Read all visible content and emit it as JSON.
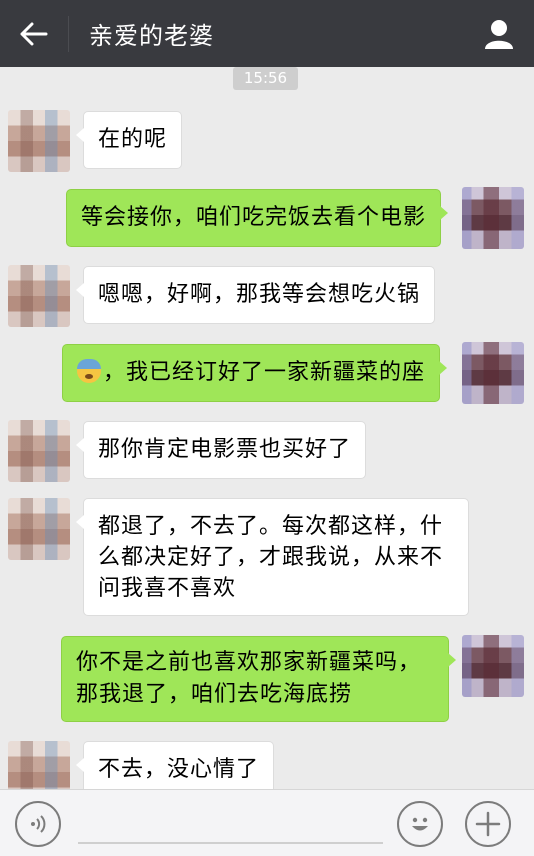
{
  "header": {
    "title": "亲爱的老婆",
    "back_icon": "arrow-left-icon",
    "profile_icon": "person-icon"
  },
  "timestamp": "15:56",
  "messages": [
    {
      "side": "in",
      "text": "在的呢"
    },
    {
      "side": "out",
      "text": "等会接你，咱们吃完饭去看个电影"
    },
    {
      "side": "in",
      "text": "嗯嗯，好啊，那我等会想吃火锅"
    },
    {
      "side": "out",
      "emoji": "anxious-face-emoji",
      "text": "，我已经订好了一家新疆菜的座"
    },
    {
      "side": "in",
      "text": "那你肯定电影票也买好了"
    },
    {
      "side": "in",
      "lines": [
        "都退了，不去了。每次都这样，什",
        "么都决定好了，才跟我说，从来不",
        "问我喜不喜欢"
      ]
    },
    {
      "side": "out",
      "lines": [
        "你不是之前也喜欢那家新疆菜吗，",
        "那我退了，咱们去吃海底捞"
      ]
    },
    {
      "side": "in",
      "text": "不去，没心情了"
    }
  ],
  "bottom_bar": {
    "voice_icon": "voice-icon",
    "emoji_icon": "smiley-icon",
    "add_icon": "plus-icon"
  },
  "colors": {
    "header_bg": "#393a3f",
    "chat_bg": "#ebebeb",
    "outgoing_bubble": "#9fe658",
    "incoming_bubble": "#ffffff"
  }
}
